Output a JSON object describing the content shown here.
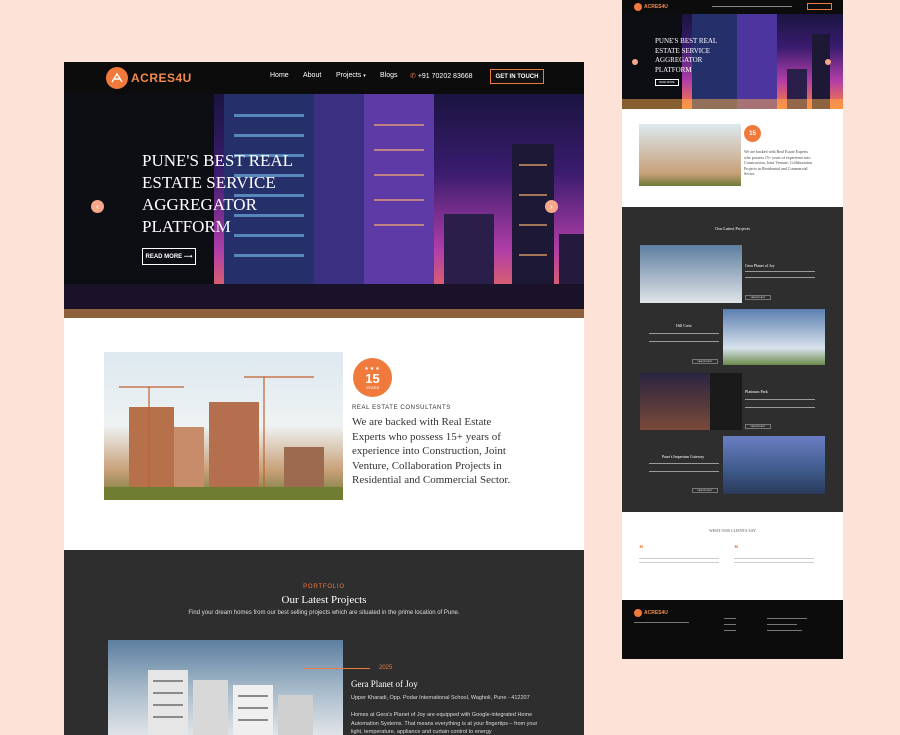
{
  "main": {
    "logo": {
      "text": "ACRES4U"
    },
    "nav": {
      "home": "Home",
      "about": "About",
      "projects": "Projects",
      "blogs": "Blogs",
      "phone": "+91 70202 83668",
      "cta": "GET IN TOUCH"
    },
    "hero": {
      "line1": "PUNE'S BEST REAL",
      "line2": "ESTATE SERVICE",
      "line3": "AGGREGATOR",
      "line4": "PLATFORM",
      "button": "READ MORE"
    },
    "about": {
      "badge_number": "15",
      "badge_label": "YEARS",
      "kicker": "REAL ESTATE CONSULTANTS",
      "text": "We are backed with Real Estate Experts who possess 15+ years of experience into Construction, Joint Venture, Collaboration Projects in Residential and Commercial Sector."
    },
    "portfolio": {
      "kicker": "PORTFOLIO",
      "title": "Our Latest Projects",
      "subtitle": "Find your dream homes from our best selling projects which are situated in the prime location of Pune.",
      "project": {
        "year": "2025",
        "name": "Gera Planet of Joy",
        "address": "Upper Kharadi, Opp. Podar International School, Wagholi, Pune - 412207",
        "description": "Homes at Gera's Planet of Joy are equipped with Google-integrated Home Automation Systems. That means everything is at your fingertips – from your light, temperature, appliance and curtain control to energy"
      }
    }
  },
  "side": {
    "logo": "ACRES4U",
    "hero": {
      "line1": "PUNE'S BEST REAL",
      "line2": "ESTATE SERVICE",
      "line3": "AGGREGATOR",
      "line4": "PLATFORM",
      "button": "READ MORE"
    },
    "about": {
      "badge_number": "15",
      "text": "We are backed with Real Estate Experts who possess 15+ years of experience into Construction, Joint Venture, Collaboration Projects in Residential and Commercial Sector."
    },
    "portfolio": {
      "title": "Our Latest Projects",
      "items": [
        {
          "name": "Gera Planet of Joy"
        },
        {
          "name": "Hill Crest"
        },
        {
          "name": "Platinum Park"
        },
        {
          "name": "Pune's Imperium Gateway"
        }
      ],
      "view": "VIEW PROJECT"
    },
    "testimonials": {
      "title": "WHAT OUR CLIENTS SAY"
    }
  },
  "colors": {
    "accent": "#f07a3c",
    "dark": "#2e2e2e",
    "navbar": "#0c0c0c",
    "background": "#fde3d7"
  }
}
